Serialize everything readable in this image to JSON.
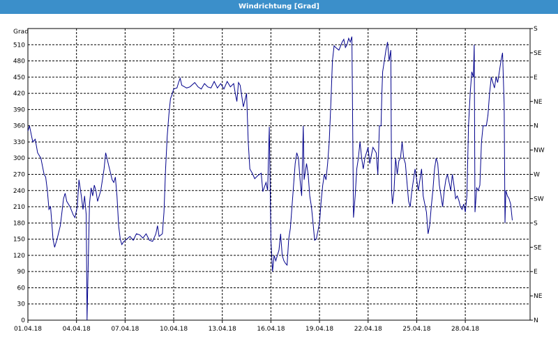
{
  "window": {
    "title": "Windrichtung [Grad]",
    "title_bar_color": "#3b8fca"
  },
  "chart_data": {
    "type": "line",
    "title": "Windrichtung [Grad]",
    "ylabel": "Grad",
    "ylim": [
      0,
      540
    ],
    "xlim": [
      0,
      31
    ],
    "grid": true,
    "left_ticks": [
      "0",
      "30",
      "60",
      "90",
      "120",
      "150",
      "180",
      "210",
      "240",
      "270",
      "300",
      "330",
      "360",
      "390",
      "420",
      "450",
      "480",
      "510"
    ],
    "right_ticks": [
      {
        "v": 0,
        "l": "N"
      },
      {
        "v": 45,
        "l": "NE"
      },
      {
        "v": 90,
        "l": "E"
      },
      {
        "v": 135,
        "l": "SE"
      },
      {
        "v": 180,
        "l": "S"
      },
      {
        "v": 225,
        "l": "SW"
      },
      {
        "v": 270,
        "l": "W"
      },
      {
        "v": 315,
        "l": "NW"
      },
      {
        "v": 360,
        "l": "N"
      },
      {
        "v": 405,
        "l": "NE"
      },
      {
        "v": 450,
        "l": "E"
      },
      {
        "v": 495,
        "l": "SE"
      },
      {
        "v": 540,
        "l": "S"
      }
    ],
    "x_labels": [
      {
        "day": 0,
        "label": "01.04.18"
      },
      {
        "day": 3,
        "label": "04.04.18"
      },
      {
        "day": 6,
        "label": "07.04.18"
      },
      {
        "day": 9,
        "label": "10.04.18"
      },
      {
        "day": 12,
        "label": "13.04.18"
      },
      {
        "day": 15,
        "label": "16.04.18"
      },
      {
        "day": 18,
        "label": "19.04.18"
      },
      {
        "day": 21,
        "label": "22.04.18"
      },
      {
        "day": 24,
        "label": "25.04.18"
      },
      {
        "day": 27,
        "label": "28.04.18"
      }
    ],
    "series": [
      {
        "color": "#00008b",
        "points": [
          [
            0.0,
            350
          ],
          [
            0.1,
            360
          ],
          [
            0.2,
            345
          ],
          [
            0.3,
            330
          ],
          [
            0.45,
            335
          ],
          [
            0.6,
            310
          ],
          [
            0.8,
            300
          ],
          [
            1.0,
            270
          ],
          [
            1.1,
            265
          ],
          [
            1.2,
            240
          ],
          [
            1.3,
            205
          ],
          [
            1.4,
            210
          ],
          [
            1.55,
            150
          ],
          [
            1.65,
            135
          ],
          [
            1.8,
            150
          ],
          [
            2.0,
            175
          ],
          [
            2.1,
            200
          ],
          [
            2.2,
            225
          ],
          [
            2.3,
            235
          ],
          [
            2.4,
            220
          ],
          [
            2.6,
            210
          ],
          [
            2.8,
            195
          ],
          [
            2.9,
            190
          ],
          [
            3.05,
            210
          ],
          [
            3.15,
            260
          ],
          [
            3.3,
            230
          ],
          [
            3.4,
            205
          ],
          [
            3.5,
            230
          ],
          [
            3.6,
            195
          ],
          [
            3.65,
            0
          ],
          [
            3.8,
            215
          ],
          [
            3.9,
            245
          ],
          [
            4.0,
            230
          ],
          [
            4.1,
            250
          ],
          [
            4.2,
            240
          ],
          [
            4.3,
            220
          ],
          [
            4.5,
            240
          ],
          [
            4.7,
            280
          ],
          [
            4.8,
            310
          ],
          [
            5.0,
            285
          ],
          [
            5.2,
            260
          ],
          [
            5.3,
            255
          ],
          [
            5.4,
            265
          ],
          [
            5.5,
            230
          ],
          [
            5.6,
            175
          ],
          [
            5.7,
            150
          ],
          [
            5.8,
            140
          ],
          [
            5.9,
            145
          ],
          [
            6.1,
            150
          ],
          [
            6.3,
            155
          ],
          [
            6.5,
            148
          ],
          [
            6.7,
            160
          ],
          [
            6.9,
            158
          ],
          [
            7.1,
            152
          ],
          [
            7.3,
            160
          ],
          [
            7.5,
            148
          ],
          [
            7.7,
            146
          ],
          [
            7.9,
            160
          ],
          [
            8.0,
            175
          ],
          [
            8.1,
            155
          ],
          [
            8.3,
            160
          ],
          [
            8.4,
            200
          ],
          [
            8.5,
            280
          ],
          [
            8.6,
            340
          ],
          [
            8.7,
            380
          ],
          [
            8.8,
            410
          ],
          [
            8.9,
            418
          ],
          [
            9.0,
            428
          ],
          [
            9.2,
            430
          ],
          [
            9.3,
            440
          ],
          [
            9.4,
            448
          ],
          [
            9.5,
            435
          ],
          [
            9.8,
            430
          ],
          [
            10.0,
            432
          ],
          [
            10.3,
            440
          ],
          [
            10.5,
            432
          ],
          [
            10.7,
            428
          ],
          [
            10.9,
            438
          ],
          [
            11.1,
            432
          ],
          [
            11.3,
            430
          ],
          [
            11.5,
            442
          ],
          [
            11.7,
            430
          ],
          [
            11.9,
            438
          ],
          [
            12.1,
            428
          ],
          [
            12.3,
            442
          ],
          [
            12.5,
            432
          ],
          [
            12.7,
            438
          ],
          [
            12.8,
            420
          ],
          [
            12.9,
            405
          ],
          [
            13.0,
            440
          ],
          [
            13.1,
            435
          ],
          [
            13.3,
            395
          ],
          [
            13.5,
            420
          ],
          [
            13.6,
            330
          ],
          [
            13.7,
            280
          ],
          [
            13.85,
            272
          ],
          [
            14.0,
            262
          ],
          [
            14.2,
            268
          ],
          [
            14.4,
            272
          ],
          [
            14.5,
            238
          ],
          [
            14.7,
            255
          ],
          [
            14.8,
            240
          ],
          [
            14.9,
            358
          ],
          [
            15.0,
            150
          ],
          [
            15.1,
            90
          ],
          [
            15.2,
            120
          ],
          [
            15.3,
            110
          ],
          [
            15.5,
            130
          ],
          [
            15.6,
            160
          ],
          [
            15.7,
            120
          ],
          [
            15.8,
            110
          ],
          [
            15.9,
            105
          ],
          [
            16.0,
            102
          ],
          [
            16.1,
            150
          ],
          [
            16.2,
            170
          ],
          [
            16.3,
            210
          ],
          [
            16.4,
            250
          ],
          [
            16.5,
            290
          ],
          [
            16.6,
            310
          ],
          [
            16.7,
            300
          ],
          [
            16.8,
            260
          ],
          [
            16.9,
            230
          ],
          [
            17.0,
            360
          ],
          [
            17.05,
            260
          ],
          [
            17.2,
            290
          ],
          [
            17.3,
            270
          ],
          [
            17.4,
            230
          ],
          [
            17.5,
            210
          ],
          [
            17.6,
            180
          ],
          [
            17.7,
            148
          ],
          [
            17.8,
            150
          ],
          [
            18.0,
            180
          ],
          [
            18.1,
            220
          ],
          [
            18.2,
            250
          ],
          [
            18.3,
            270
          ],
          [
            18.4,
            260
          ],
          [
            18.5,
            290
          ],
          [
            18.6,
            330
          ],
          [
            18.7,
            400
          ],
          [
            18.8,
            480
          ],
          [
            18.9,
            508
          ],
          [
            19.0,
            505
          ],
          [
            19.2,
            500
          ],
          [
            19.4,
            515
          ],
          [
            19.5,
            520
          ],
          [
            19.6,
            505
          ],
          [
            19.7,
            510
          ],
          [
            19.8,
            522
          ],
          [
            19.9,
            515
          ],
          [
            20.0,
            525
          ],
          [
            20.1,
            190
          ],
          [
            20.2,
            230
          ],
          [
            20.3,
            280
          ],
          [
            20.4,
            300
          ],
          [
            20.5,
            330
          ],
          [
            20.6,
            300
          ],
          [
            20.7,
            280
          ],
          [
            20.8,
            300
          ],
          [
            21.0,
            320
          ],
          [
            21.1,
            290
          ],
          [
            21.3,
            320
          ],
          [
            21.5,
            310
          ],
          [
            21.6,
            270
          ],
          [
            21.7,
            360
          ],
          [
            21.8,
            360
          ],
          [
            21.85,
            420
          ],
          [
            21.9,
            460
          ],
          [
            22.0,
            480
          ],
          [
            22.1,
            500
          ],
          [
            22.2,
            515
          ],
          [
            22.3,
            480
          ],
          [
            22.4,
            500
          ],
          [
            22.45,
            240
          ],
          [
            22.5,
            215
          ],
          [
            22.6,
            240
          ],
          [
            22.7,
            300
          ],
          [
            22.8,
            270
          ],
          [
            22.9,
            295
          ],
          [
            23.0,
            300
          ],
          [
            23.1,
            330
          ],
          [
            23.2,
            300
          ],
          [
            23.3,
            290
          ],
          [
            23.5,
            220
          ],
          [
            23.6,
            210
          ],
          [
            23.7,
            240
          ],
          [
            23.8,
            260
          ],
          [
            23.9,
            280
          ],
          [
            24.0,
            260
          ],
          [
            24.1,
            240
          ],
          [
            24.3,
            280
          ],
          [
            24.4,
            230
          ],
          [
            24.5,
            215
          ],
          [
            24.6,
            200
          ],
          [
            24.7,
            160
          ],
          [
            24.8,
            175
          ],
          [
            24.9,
            210
          ],
          [
            25.0,
            240
          ],
          [
            25.1,
            280
          ],
          [
            25.2,
            300
          ],
          [
            25.3,
            290
          ],
          [
            25.4,
            250
          ],
          [
            25.5,
            230
          ],
          [
            25.6,
            210
          ],
          [
            25.7,
            240
          ],
          [
            25.8,
            260
          ],
          [
            25.9,
            270
          ],
          [
            26.0,
            255
          ],
          [
            26.1,
            240
          ],
          [
            26.2,
            270
          ],
          [
            26.3,
            250
          ],
          [
            26.4,
            225
          ],
          [
            26.5,
            230
          ],
          [
            26.6,
            222
          ],
          [
            26.7,
            210
          ],
          [
            26.8,
            205
          ],
          [
            26.9,
            215
          ],
          [
            27.0,
            200
          ],
          [
            27.1,
            230
          ],
          [
            27.2,
            360
          ],
          [
            27.3,
            420
          ],
          [
            27.4,
            460
          ],
          [
            27.5,
            450
          ],
          [
            27.55,
            510
          ],
          [
            27.6,
            200
          ],
          [
            27.7,
            245
          ],
          [
            27.8,
            240
          ],
          [
            27.9,
            250
          ],
          [
            28.0,
            330
          ],
          [
            28.1,
            360
          ],
          [
            28.3,
            360
          ],
          [
            28.4,
            380
          ],
          [
            28.5,
            420
          ],
          [
            28.6,
            450
          ],
          [
            28.7,
            440
          ],
          [
            28.8,
            430
          ],
          [
            28.9,
            450
          ],
          [
            29.0,
            440
          ],
          [
            29.1,
            460
          ],
          [
            29.2,
            480
          ],
          [
            29.3,
            495
          ],
          [
            29.4,
            400
          ],
          [
            29.45,
            180
          ],
          [
            29.5,
            240
          ],
          [
            29.6,
            230
          ],
          [
            29.7,
            225
          ],
          [
            29.8,
            215
          ],
          [
            29.9,
            185
          ]
        ]
      }
    ]
  }
}
